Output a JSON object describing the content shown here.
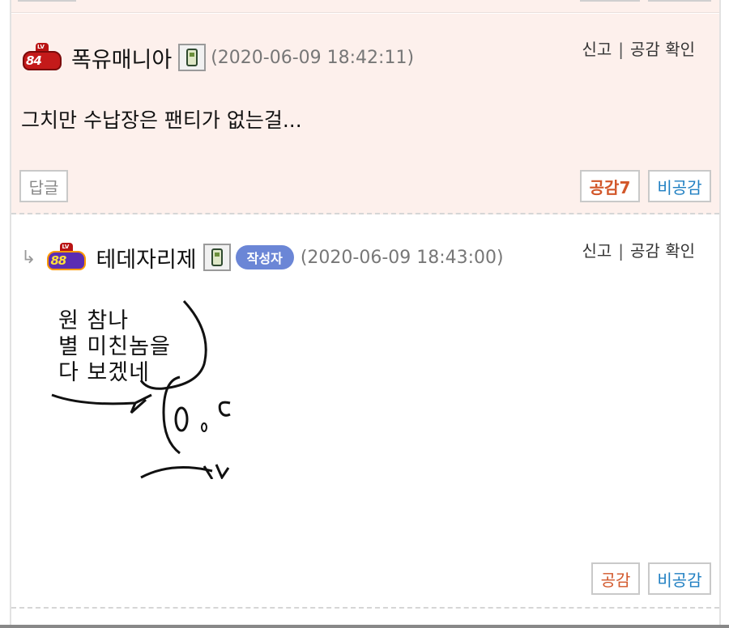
{
  "comments": [
    {
      "level": "84",
      "level_tag": "LV",
      "nickname": "폭유매니아",
      "date": "(2020-06-09 18:42:11)",
      "report": "신고",
      "check_likes": "공감 확인",
      "text": "그치만 수납장은 팬티가 없는걸...",
      "reply_label": "답글",
      "like_label": "공감7",
      "dislike_label": "비공감"
    },
    {
      "reply_arrow": "↳",
      "level": "88",
      "level_tag": "LV",
      "nickname": "테데자리제",
      "author_badge": "작성자",
      "date": "(2020-06-09 18:43:00)",
      "report": "신고",
      "check_likes": "공감 확인",
      "image_text": [
        "원 참나",
        "별 미친놈을",
        "다 보겠네"
      ],
      "like_label": "공감",
      "dislike_label": "비공감"
    }
  ],
  "colors": {
    "comment_bg": "#fdf0ec",
    "like": "#d2572a",
    "dislike": "#1f7fc2",
    "badge": "#6b86d6"
  }
}
